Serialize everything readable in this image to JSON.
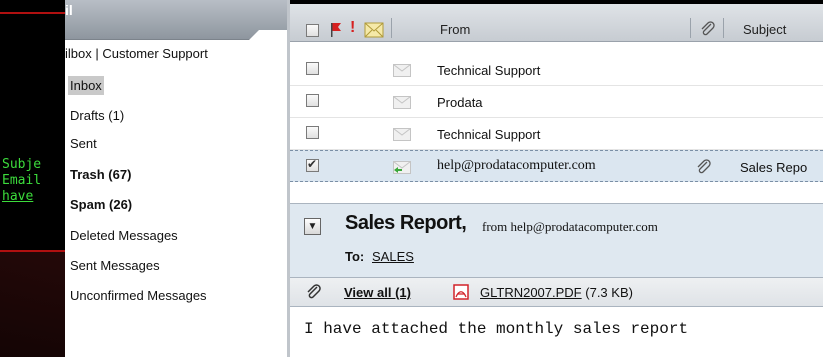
{
  "terminal": {
    "lines": [
      "Subje",
      "Email",
      " have"
    ]
  },
  "sidebar": {
    "header_title": "il",
    "account_label": "ilbox | Customer Support",
    "folders": [
      {
        "label": "Inbox",
        "selected": true,
        "bold": false
      },
      {
        "label": "Drafts (1)",
        "selected": false,
        "bold": false
      },
      {
        "label": "Sent",
        "selected": false,
        "bold": false
      },
      {
        "label": "Trash (67)",
        "selected": false,
        "bold": true
      },
      {
        "label": "Spam (26)",
        "selected": false,
        "bold": true
      },
      {
        "label": "Deleted Messages",
        "selected": false,
        "bold": false
      },
      {
        "label": "Sent Messages",
        "selected": false,
        "bold": false
      },
      {
        "label": "Unconfirmed Messages",
        "selected": false,
        "bold": false
      }
    ]
  },
  "message_list": {
    "columns": {
      "from": "From",
      "subject": "Subject"
    },
    "rows": [
      {
        "from": "Technical Support",
        "subject": "",
        "checked": false,
        "selected": false,
        "attachment": false
      },
      {
        "from": "Prodata",
        "subject": "",
        "checked": false,
        "selected": false,
        "attachment": false
      },
      {
        "from": "Technical Support",
        "subject": "",
        "checked": false,
        "selected": false,
        "attachment": false
      },
      {
        "from": "help@prodatacomputer.com",
        "subject": "Sales Repo",
        "checked": true,
        "selected": true,
        "attachment": true
      }
    ]
  },
  "reading_pane": {
    "subject": "Sales Report,",
    "from_prefix": "from help@prodatacomputer.com",
    "to_label": "To:",
    "to_value": "SALES",
    "view_all": "View all (1)",
    "attachment_file": "GLTRN2007.PDF",
    "attachment_size": "(7.3 KB)",
    "body": "I have attached the monthly sales report"
  },
  "colors": {
    "terminal_text": "#3cdc3c",
    "terminal_border": "#b01010",
    "selected_row": "#dbe6f0",
    "pdf_red": "#d2232a"
  }
}
